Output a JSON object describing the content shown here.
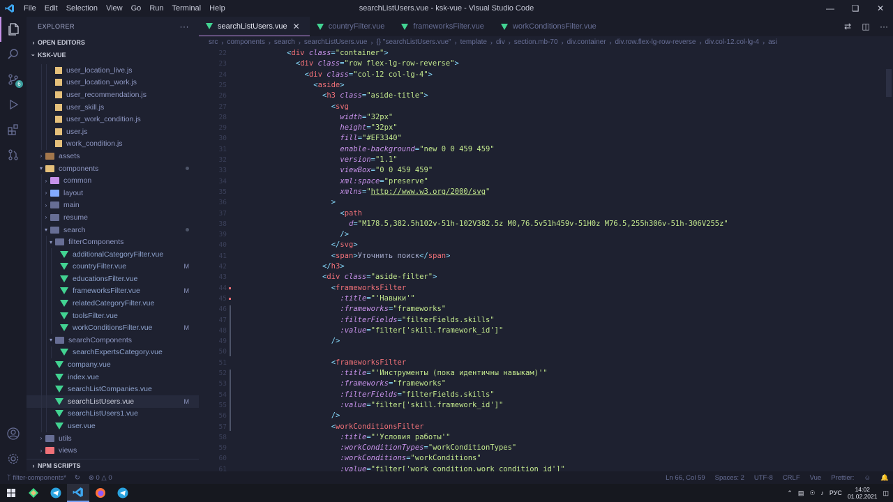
{
  "window": {
    "title": "searchListUsers.vue - ksk-vue - Visual Studio Code",
    "menu": [
      "File",
      "Edit",
      "Selection",
      "View",
      "Go",
      "Run",
      "Terminal",
      "Help"
    ]
  },
  "activity": {
    "scm_badge": "6"
  },
  "sidebar": {
    "header": "EXPLORER",
    "open_editors": "OPEN EDITORS",
    "project": "KSK-VUE",
    "npm_scripts": "NPM SCRIPTS"
  },
  "tree": [
    {
      "label": "user_location_live.js",
      "type": "js",
      "depth": 3
    },
    {
      "label": "user_location_work.js",
      "type": "js",
      "depth": 3
    },
    {
      "label": "user_recommendation.js",
      "type": "js",
      "depth": 3
    },
    {
      "label": "user_skill.js",
      "type": "js",
      "depth": 3
    },
    {
      "label": "user_work_condition.js",
      "type": "js",
      "depth": 3
    },
    {
      "label": "user.js",
      "type": "js",
      "depth": 3
    },
    {
      "label": "work_condition.js",
      "type": "js",
      "depth": 3
    },
    {
      "label": "assets",
      "type": "folder",
      "depth": 1,
      "open": false,
      "color": "#a3774c"
    },
    {
      "label": "components",
      "type": "folder",
      "depth": 1,
      "open": true,
      "color": "#e5c07b",
      "dot": true
    },
    {
      "label": "common",
      "type": "folder",
      "depth": 2,
      "open": false,
      "color": "#c792ea"
    },
    {
      "label": "layout",
      "type": "folder",
      "depth": 2,
      "open": false,
      "color": "#82aaff"
    },
    {
      "label": "main",
      "type": "folder",
      "depth": 2,
      "open": false,
      "color": "#676e95"
    },
    {
      "label": "resume",
      "type": "folder",
      "depth": 2,
      "open": false,
      "color": "#676e95"
    },
    {
      "label": "search",
      "type": "folder",
      "depth": 2,
      "open": true,
      "color": "#676e95",
      "dot": true
    },
    {
      "label": "filterComponents",
      "type": "folder",
      "depth": 3,
      "open": true,
      "color": "#676e95"
    },
    {
      "label": "additionalCategoryFilter.vue",
      "type": "vue",
      "depth": 4
    },
    {
      "label": "countryFilter.vue",
      "type": "vue",
      "depth": 4,
      "mod": "M"
    },
    {
      "label": "educationsFilter.vue",
      "type": "vue",
      "depth": 4
    },
    {
      "label": "frameworksFilter.vue",
      "type": "vue",
      "depth": 4,
      "mod": "M"
    },
    {
      "label": "relatedCategoryFilter.vue",
      "type": "vue",
      "depth": 4
    },
    {
      "label": "toolsFilter.vue",
      "type": "vue",
      "depth": 4
    },
    {
      "label": "workConditionsFilter.vue",
      "type": "vue",
      "depth": 4,
      "mod": "M"
    },
    {
      "label": "searchComponents",
      "type": "folder",
      "depth": 3,
      "open": true,
      "color": "#676e95"
    },
    {
      "label": "searchExpertsCategory.vue",
      "type": "vue",
      "depth": 4
    },
    {
      "label": "company.vue",
      "type": "vue",
      "depth": 3
    },
    {
      "label": "index.vue",
      "type": "vue",
      "depth": 3
    },
    {
      "label": "searchListCompanies.vue",
      "type": "vue",
      "depth": 3
    },
    {
      "label": "searchListUsers.vue",
      "type": "vue",
      "depth": 3,
      "mod": "M",
      "selected": true
    },
    {
      "label": "searchListUsers1.vue",
      "type": "vue",
      "depth": 3
    },
    {
      "label": "user.vue",
      "type": "vue",
      "depth": 3
    },
    {
      "label": "utils",
      "type": "folder",
      "depth": 1,
      "open": false,
      "color": "#676e95"
    },
    {
      "label": "views",
      "type": "folder",
      "depth": 1,
      "open": false,
      "color": "#f07178"
    }
  ],
  "tabs": [
    {
      "label": "searchListUsers.vue",
      "active": true
    },
    {
      "label": "countryFilter.vue",
      "active": false
    },
    {
      "label": "frameworksFilter.vue",
      "active": false
    },
    {
      "label": "workConditionsFilter.vue",
      "active": false
    }
  ],
  "breadcrumb": [
    "src",
    "components",
    "search",
    "searchListUsers.vue",
    "{} \"searchListUsers.vue\"",
    "template",
    "div",
    "section.mb-70",
    "div.container",
    "div.row.flex-lg-row-reverse",
    "div.col-12.col-lg-4",
    "asi"
  ],
  "code_lines": [
    {
      "n": "22",
      "i": 6,
      "t": [
        [
          "br",
          "<"
        ],
        [
          "tg",
          "div "
        ],
        [
          "at",
          "class"
        ],
        [
          "br",
          "="
        ],
        [
          "st",
          "\"container\""
        ],
        [
          "br",
          ">"
        ]
      ]
    },
    {
      "n": "23",
      "i": 7,
      "t": [
        [
          "br",
          "<"
        ],
        [
          "tg",
          "div "
        ],
        [
          "at",
          "class"
        ],
        [
          "br",
          "="
        ],
        [
          "st",
          "\"row flex-lg-row-reverse\""
        ],
        [
          "br",
          ">"
        ]
      ]
    },
    {
      "n": "24",
      "i": 8,
      "t": [
        [
          "br",
          "<"
        ],
        [
          "tg",
          "div "
        ],
        [
          "at",
          "class"
        ],
        [
          "br",
          "="
        ],
        [
          "st",
          "\"col-12 col-lg-4\""
        ],
        [
          "br",
          ">"
        ]
      ]
    },
    {
      "n": "25",
      "i": 9,
      "t": [
        [
          "br",
          "<"
        ],
        [
          "tg",
          "aside"
        ],
        [
          "br",
          ">"
        ]
      ]
    },
    {
      "n": "26",
      "i": 10,
      "t": [
        [
          "br",
          "<"
        ],
        [
          "tg",
          "h3 "
        ],
        [
          "at",
          "class"
        ],
        [
          "br",
          "="
        ],
        [
          "st",
          "\"aside-title\""
        ],
        [
          "br",
          ">"
        ]
      ]
    },
    {
      "n": "27",
      "i": 11,
      "t": [
        [
          "br",
          "<"
        ],
        [
          "tg",
          "svg"
        ]
      ]
    },
    {
      "n": "28",
      "i": 12,
      "t": [
        [
          "at",
          "width"
        ],
        [
          "br",
          "="
        ],
        [
          "st",
          "\"32px\""
        ]
      ]
    },
    {
      "n": "29",
      "i": 12,
      "t": [
        [
          "at",
          "height"
        ],
        [
          "br",
          "="
        ],
        [
          "st",
          "\"32px\""
        ]
      ]
    },
    {
      "n": "30",
      "i": 12,
      "t": [
        [
          "at",
          "fill"
        ],
        [
          "br",
          "="
        ],
        [
          "st",
          "\"#EF3340\""
        ]
      ]
    },
    {
      "n": "31",
      "i": 12,
      "t": [
        [
          "at",
          "enable-background"
        ],
        [
          "br",
          "="
        ],
        [
          "st",
          "\"new 0 0 459 459\""
        ]
      ]
    },
    {
      "n": "32",
      "i": 12,
      "t": [
        [
          "at",
          "version"
        ],
        [
          "br",
          "="
        ],
        [
          "st",
          "\"1.1\""
        ]
      ]
    },
    {
      "n": "33",
      "i": 12,
      "t": [
        [
          "at",
          "viewBox"
        ],
        [
          "br",
          "="
        ],
        [
          "st",
          "\"0 0 459 459\""
        ]
      ]
    },
    {
      "n": "34",
      "i": 12,
      "t": [
        [
          "at",
          "xml:space"
        ],
        [
          "br",
          "="
        ],
        [
          "st",
          "\"preserve\""
        ]
      ]
    },
    {
      "n": "35",
      "i": 12,
      "t": [
        [
          "at",
          "xmlns"
        ],
        [
          "br",
          "="
        ],
        [
          "st",
          "\""
        ],
        [
          "stu",
          "http://www.w3.org/2000/svg"
        ],
        [
          "st",
          "\""
        ]
      ]
    },
    {
      "n": "36",
      "i": 11,
      "t": [
        [
          "br",
          ">"
        ]
      ]
    },
    {
      "n": "37",
      "i": 12,
      "t": [
        [
          "br",
          "<"
        ],
        [
          "tg",
          "path"
        ]
      ]
    },
    {
      "n": "38",
      "i": 13,
      "t": [
        [
          "at",
          "d"
        ],
        [
          "br",
          "="
        ],
        [
          "st",
          "\"M178.5,382.5h102v-51h-102V382.5z M0,76.5v51h459v-51H0z M76.5,255h306v-51h-306V255z\""
        ]
      ]
    },
    {
      "n": "39",
      "i": 12,
      "t": [
        [
          "br",
          "/>"
        ]
      ]
    },
    {
      "n": "40",
      "i": 11,
      "t": [
        [
          "br",
          "</"
        ],
        [
          "tg",
          "svg"
        ],
        [
          "br",
          ">"
        ]
      ]
    },
    {
      "n": "41",
      "i": 11,
      "t": [
        [
          "br",
          "<"
        ],
        [
          "tg",
          "span"
        ],
        [
          "br",
          ">"
        ],
        [
          "tx",
          "Уточнить поиск"
        ],
        [
          "br",
          "</"
        ],
        [
          "tg",
          "span"
        ],
        [
          "br",
          ">"
        ]
      ]
    },
    {
      "n": "42",
      "i": 10,
      "t": [
        [
          "br",
          "</"
        ],
        [
          "tg",
          "h3"
        ],
        [
          "br",
          ">"
        ]
      ]
    },
    {
      "n": "43",
      "i": 10,
      "t": [
        [
          "br",
          "<"
        ],
        [
          "tg",
          "div "
        ],
        [
          "at",
          "class"
        ],
        [
          "br",
          "="
        ],
        [
          "st",
          "\"aside-filter\""
        ],
        [
          "br",
          ">"
        ]
      ]
    },
    {
      "n": "44",
      "i": 11,
      "t": [
        [
          "br",
          "<"
        ],
        [
          "tg",
          "frameworksFilter"
        ]
      ]
    },
    {
      "n": "45",
      "i": 12,
      "t": [
        [
          "at",
          ":title"
        ],
        [
          "br",
          "="
        ],
        [
          "st",
          "\"'Навыки'\""
        ]
      ]
    },
    {
      "n": "46",
      "i": 12,
      "t": [
        [
          "at",
          ":frameworks"
        ],
        [
          "br",
          "="
        ],
        [
          "st",
          "\"frameworks\""
        ]
      ]
    },
    {
      "n": "47",
      "i": 12,
      "t": [
        [
          "at",
          ":filterFields"
        ],
        [
          "br",
          "="
        ],
        [
          "st",
          "\"filterFields.skills\""
        ]
      ]
    },
    {
      "n": "48",
      "i": 12,
      "t": [
        [
          "at",
          ":value"
        ],
        [
          "br",
          "="
        ],
        [
          "st",
          "\"filter['skill.framework_id']\""
        ]
      ]
    },
    {
      "n": "49",
      "i": 11,
      "t": [
        [
          "br",
          "/>"
        ]
      ]
    },
    {
      "n": "50",
      "i": 0,
      "t": []
    },
    {
      "n": "51",
      "i": 11,
      "t": [
        [
          "br",
          "<"
        ],
        [
          "tg",
          "frameworksFilter"
        ]
      ]
    },
    {
      "n": "52",
      "i": 12,
      "t": [
        [
          "at",
          ":title"
        ],
        [
          "br",
          "="
        ],
        [
          "st",
          "\"'Инструменты (пока идентичны навыкам)'\""
        ]
      ]
    },
    {
      "n": "53",
      "i": 12,
      "t": [
        [
          "at",
          ":frameworks"
        ],
        [
          "br",
          "="
        ],
        [
          "st",
          "\"frameworks\""
        ]
      ]
    },
    {
      "n": "54",
      "i": 12,
      "t": [
        [
          "at",
          ":filterFields"
        ],
        [
          "br",
          "="
        ],
        [
          "st",
          "\"filterFields.skills\""
        ]
      ]
    },
    {
      "n": "55",
      "i": 12,
      "t": [
        [
          "at",
          ":value"
        ],
        [
          "br",
          "="
        ],
        [
          "st",
          "\"filter['skill.framework_id']\""
        ]
      ]
    },
    {
      "n": "56",
      "i": 11,
      "t": [
        [
          "br",
          "/>"
        ]
      ]
    },
    {
      "n": "57",
      "i": 11,
      "t": [
        [
          "br",
          "<"
        ],
        [
          "tg",
          "workConditionsFilter"
        ]
      ]
    },
    {
      "n": "58",
      "i": 12,
      "t": [
        [
          "at",
          ":title"
        ],
        [
          "br",
          "="
        ],
        [
          "st",
          "\"'Условия работы'\""
        ]
      ]
    },
    {
      "n": "59",
      "i": 12,
      "t": [
        [
          "at",
          ":workConditionTypes"
        ],
        [
          "br",
          "="
        ],
        [
          "st",
          "\"workConditionTypes\""
        ]
      ]
    },
    {
      "n": "60",
      "i": 12,
      "t": [
        [
          "at",
          ":workConditions"
        ],
        [
          "br",
          "="
        ],
        [
          "st",
          "\"workConditions\""
        ]
      ]
    },
    {
      "n": "61",
      "i": 12,
      "t": [
        [
          "at",
          ":value"
        ],
        [
          "br",
          "="
        ],
        [
          "st",
          "\"filter['work_condition.work_condition_id']\""
        ]
      ]
    }
  ],
  "status": {
    "branch": "filter-components*",
    "errors": "0",
    "warnings": "0",
    "position": "Ln 66, Col 59",
    "spaces": "Spaces: 2",
    "encoding": "UTF-8",
    "eol": "CRLF",
    "language": "Vue",
    "formatter": "Prettier:"
  },
  "taskbar": {
    "lang": "РУС",
    "time": "14:02",
    "date": "01.02.2021"
  },
  "colors": {
    "accent": "#c792ea",
    "vue_green": "#42d392",
    "js_yellow": "#e5c07b",
    "bg": "#1e2130"
  }
}
